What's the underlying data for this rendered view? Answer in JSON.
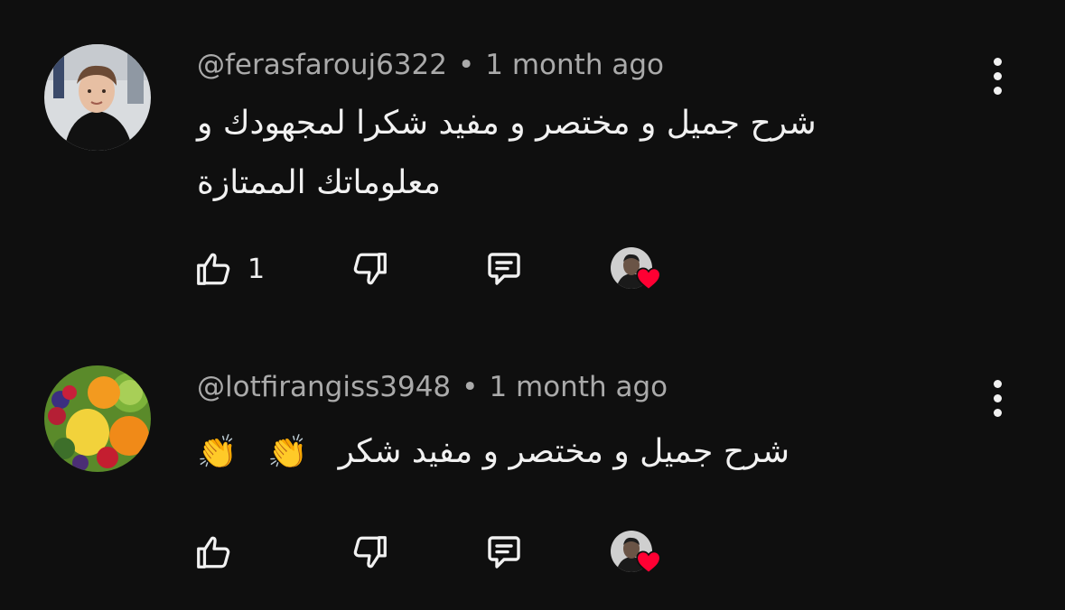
{
  "comments": [
    {
      "author": "@ferasfarouj6322",
      "separator": "•",
      "time": "1 month ago",
      "text": "شرح جميل و مختصر و مفيد شكرا لمجهودك و معلوماتك الممتازة",
      "like_count": "1",
      "avatar_icon": "child-photo-avatar",
      "creator_heart": true
    },
    {
      "author": "@lotfirangiss3948",
      "separator": "•",
      "time": "1 month ago",
      "text": "شرح جميل و مختصر و مفيد شكر",
      "emojis": [
        "👏",
        "👏"
      ],
      "like_count": "",
      "avatar_icon": "fruit-photo-avatar",
      "creator_heart": true
    }
  ],
  "colors": {
    "background": "#0f0f0f",
    "meta_text": "#aaaaaa",
    "primary_text": "#f1f1f1",
    "heart": "#ff0033"
  }
}
